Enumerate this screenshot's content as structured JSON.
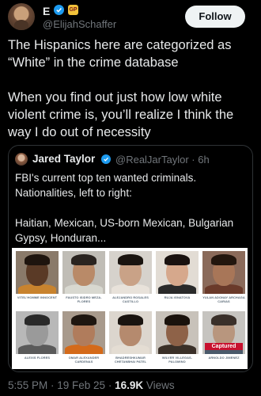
{
  "author": {
    "display_name": "E",
    "handle": "@ElijahSchaffer",
    "badge_text": "GP",
    "follow_label": "Follow"
  },
  "tweet": {
    "paragraph_1": "The Hispanics here are categorized as “White” in the crime database",
    "paragraph_2": "When you find out just how low white violent crime is, you’ll realize I think the way I do out of necessity"
  },
  "quoted": {
    "display_name": "Jared Taylor",
    "handle_time": "@RealJarTaylor · 6h",
    "paragraph_1": "FBI's current top ten wanted criminals. Nationalities, left to right:",
    "paragraph_2": "Haitian, Mexican, US-born Mexican, Bulgarian Gypsy, Honduran..."
  },
  "wanted": [
    {
      "label": "VITEL'HOMME INNOCENT",
      "skin": "#5a3a26",
      "hair": "#1e140e",
      "shirt": "#c8832e",
      "bg": "#8a7a6a"
    },
    {
      "label": "FAUSTO ISIDRO MEZA-FLORES",
      "skin": "#b98a68",
      "hair": "#2a2420",
      "shirt": "#d8d8d0",
      "bg": "#c0bdb6"
    },
    {
      "label": "ALEJANDRO ROSALES CASTILLO",
      "skin": "#c9a287",
      "hair": "#1a1410",
      "shirt": "#e8e2da",
      "bg": "#d6d2cc"
    },
    {
      "label": "RUJA IGNATOVA",
      "skin": "#d6a88c",
      "hair": "#1a1210",
      "shirt": "#2a2a2a",
      "bg": "#e2dcd4"
    },
    {
      "label": "YULAN ADONAY ARCHAGA CARIAS",
      "skin": "#a87658",
      "hair": "#22160e",
      "shirt": "#6a3a2a",
      "bg": "#8a6a5a"
    },
    {
      "label": "ALEXIS FLORES",
      "skin": "#9a9a9a",
      "hair": "#2a2a2a",
      "shirt": "#5a5a5a",
      "bg": "#b8b8b8"
    },
    {
      "label": "OMAR ALEXANDER CARDENAS",
      "skin": "#b07c5c",
      "hair": "#1e1610",
      "shirt": "#d46a1a",
      "bg": "#a89a8c"
    },
    {
      "label": "BHADRESHKUMAR CHETANBHAI PATEL",
      "skin": "#b58a6e",
      "hair": "#1a1410",
      "shirt": "#e4ddd3",
      "bg": "#dcd6ce"
    },
    {
      "label": "WILVER VILLEGAS-PALOMINO",
      "skin": "#8e6248",
      "hair": "#1a120c",
      "shirt": "#3a3028",
      "bg": "#c8c2ba"
    },
    {
      "label": "ARNOLDO JIMENEZ",
      "skin": "#b8967e",
      "hair": "#3a302a",
      "shirt": "#4a5a6a",
      "bg": "#c6c4c0",
      "captured": "Captured"
    }
  ],
  "meta": {
    "time_date": "5:55 PM · 19 Feb 25 · ",
    "views_count": "16.9K",
    "views_label": " Views"
  }
}
